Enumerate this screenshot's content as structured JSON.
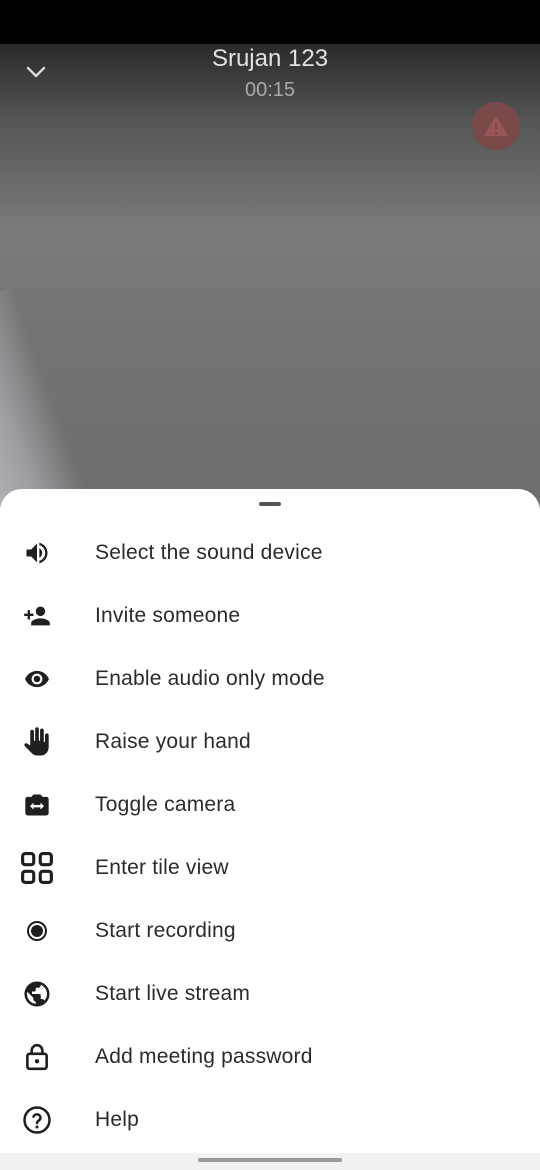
{
  "call": {
    "title": "Srujan 123",
    "timer": "00:15"
  },
  "colors": {
    "sheet_background": "#ffffff",
    "text": "#2b2b2b",
    "icon": "#1f1f1f",
    "warning_badge": "#7a4a4a"
  },
  "menu": {
    "items": [
      {
        "icon": "volume-icon",
        "label": "Select the sound device"
      },
      {
        "icon": "person-add-icon",
        "label": "Invite someone"
      },
      {
        "icon": "eye-icon",
        "label": "Enable audio only mode"
      },
      {
        "icon": "raise-hand-icon",
        "label": "Raise your hand"
      },
      {
        "icon": "switch-camera-icon",
        "label": "Toggle camera"
      },
      {
        "icon": "tile-view-icon",
        "label": "Enter tile view"
      },
      {
        "icon": "record-icon",
        "label": "Start recording"
      },
      {
        "icon": "globe-icon",
        "label": "Start live stream"
      },
      {
        "icon": "lock-icon",
        "label": "Add meeting password"
      },
      {
        "icon": "help-icon",
        "label": "Help"
      }
    ]
  }
}
